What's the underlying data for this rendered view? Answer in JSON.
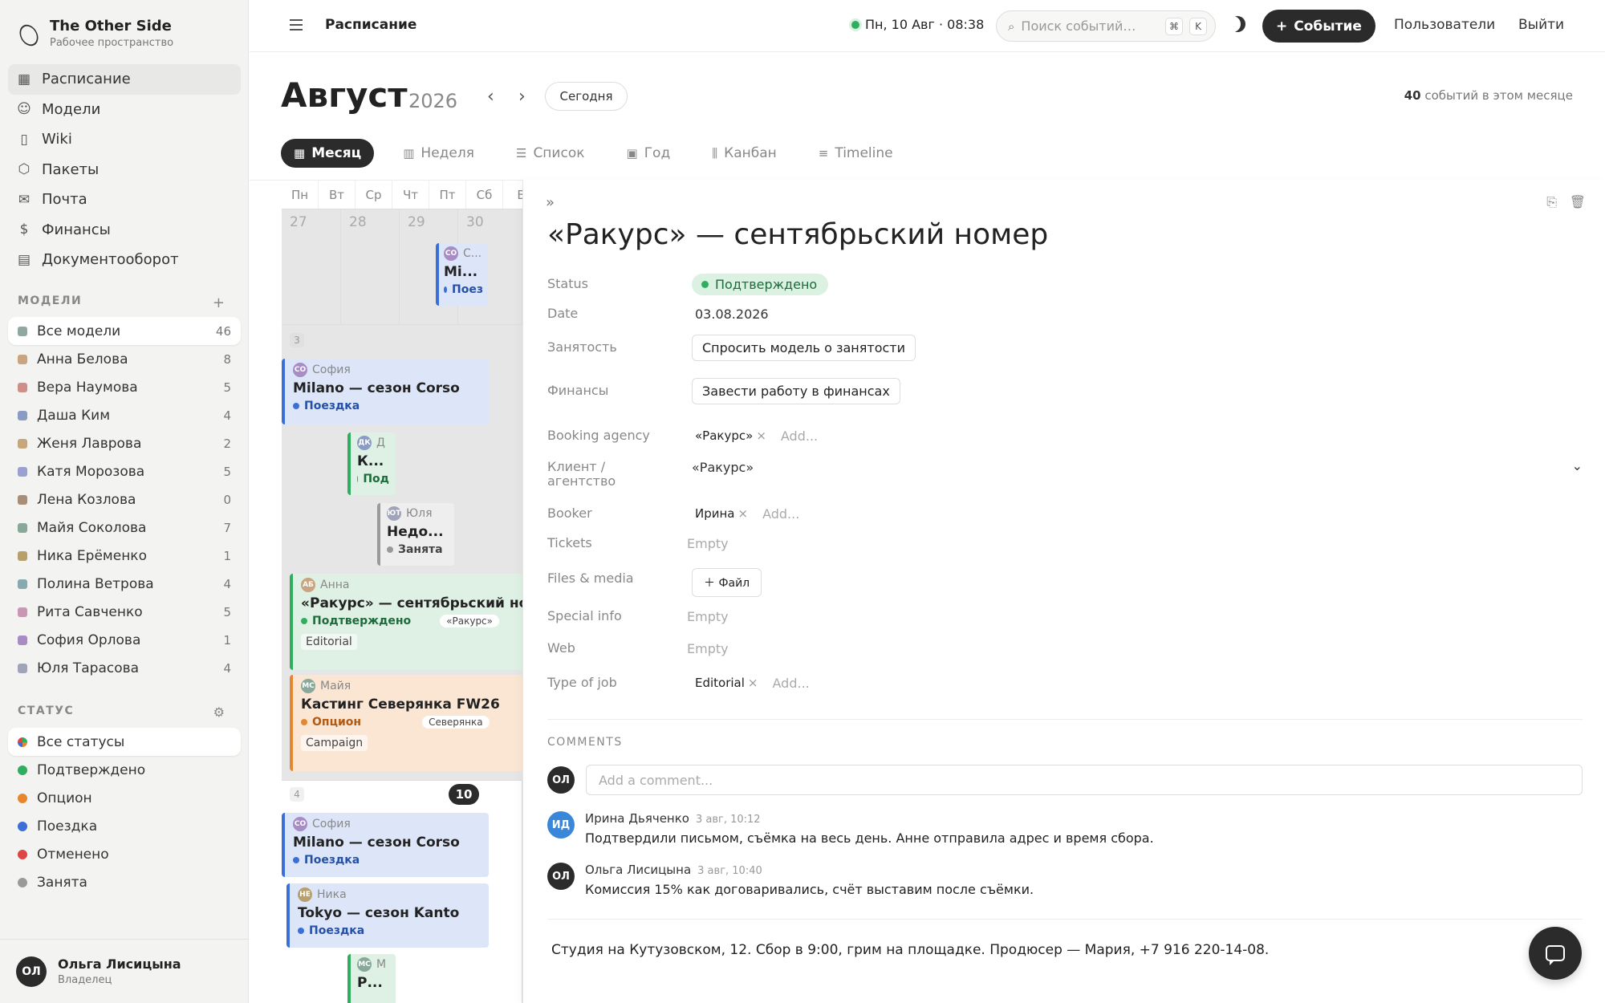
{
  "brand": {
    "title": "The Other Side",
    "subtitle": "Рабочее пространство"
  },
  "nav": {
    "items": [
      {
        "label": "Расписание",
        "icon": "calendar-icon",
        "glyph": "▦"
      },
      {
        "label": "Модели",
        "icon": "users-icon",
        "glyph": "☺"
      },
      {
        "label": "Wiki",
        "icon": "book-icon",
        "glyph": "▯"
      },
      {
        "label": "Пакеты",
        "icon": "package-icon",
        "glyph": "⬡"
      },
      {
        "label": "Почта",
        "icon": "mail-icon",
        "glyph": "✉"
      },
      {
        "label": "Финансы",
        "icon": "dollar-icon",
        "glyph": "$"
      },
      {
        "label": "Документооборот",
        "icon": "document-icon",
        "glyph": "▤"
      }
    ]
  },
  "models": {
    "heading": "МОДЕЛИ",
    "items": [
      {
        "label": "Все модели",
        "count": "46",
        "color": "#8fa8a0"
      },
      {
        "label": "Анна Белова",
        "count": "8",
        "color": "#c9a47e"
      },
      {
        "label": "Вера Наумова",
        "count": "5",
        "color": "#cf8e88"
      },
      {
        "label": "Даша Ким",
        "count": "4",
        "color": "#8a9cc4"
      },
      {
        "label": "Женя Лаврова",
        "count": "2",
        "color": "#c7a67c"
      },
      {
        "label": "Катя Морозова",
        "count": "5",
        "color": "#9aa0cf"
      },
      {
        "label": "Лена Козлова",
        "count": "0",
        "color": "#a88d78"
      },
      {
        "label": "Майя Соколова",
        "count": "7",
        "color": "#88a89a"
      },
      {
        "label": "Ника Ерёменко",
        "count": "1",
        "color": "#b8a06c"
      },
      {
        "label": "Полина Ветрова",
        "count": "4",
        "color": "#86aab0"
      },
      {
        "label": "Рита Савченко",
        "count": "5",
        "color": "#c996b4"
      },
      {
        "label": "София Орлова",
        "count": "1",
        "color": "#a88cc4"
      },
      {
        "label": "Юля Тарасова",
        "count": "4",
        "color": "#a0a4b8"
      }
    ]
  },
  "statuses": {
    "heading": "СТАТУС",
    "items": [
      {
        "label": "Все статусы",
        "color": "#e08a3a"
      },
      {
        "label": "Подтверждено",
        "color": "#2fae5f"
      },
      {
        "label": "Опцион",
        "color": "#e6862f"
      },
      {
        "label": "Поездка",
        "color": "#3a6fd8"
      },
      {
        "label": "Отменено",
        "color": "#e04545"
      },
      {
        "label": "Занята",
        "color": "#9a9a9a"
      }
    ]
  },
  "user": {
    "initials": "ОЛ",
    "name": "Ольга Лисицына",
    "role": "Владелец"
  },
  "topbar": {
    "title": "Расписание",
    "datetime": "Пн, 10 Авг · 08:38",
    "search_placeholder": "Поиск событий…",
    "kbd1": "⌘",
    "kbd2": "K",
    "new_event": "Событие",
    "users": "Пользователи",
    "logout": "Выйти"
  },
  "header": {
    "month": "Август",
    "year": "2026",
    "prev": "‹",
    "next": "›",
    "today": "Сегодня",
    "count": "40",
    "count_suffix": "событий в этом месяце"
  },
  "views": [
    {
      "label": "Месяц",
      "glyph": "▦"
    },
    {
      "label": "Неделя",
      "glyph": "▥"
    },
    {
      "label": "Список",
      "glyph": "☰"
    },
    {
      "label": "Год",
      "glyph": "▣"
    },
    {
      "label": "Канбан",
      "glyph": "⫼"
    },
    {
      "label": "Timeline",
      "glyph": "≡"
    }
  ],
  "calendar": {
    "dows": [
      "Пн",
      "Вт",
      "Ср",
      "Чт",
      "Пт",
      "Сб",
      "В"
    ],
    "week1": {
      "days": [
        "27",
        "28",
        "29",
        "30"
      ]
    },
    "week2": {
      "num": "3"
    },
    "week3": {
      "num": "4",
      "today": "10"
    },
    "events": [
      {
        "who": "С...",
        "initials": "СО",
        "avcolor": "#a88cc4",
        "title": "Mi...",
        "status": "Поез"
      },
      {
        "who": "София",
        "initials": "СО",
        "avcolor": "#a88cc4",
        "title": "Milano — сезон Corso",
        "status": "Поездка"
      },
      {
        "who": "Д",
        "initials": "ДК",
        "avcolor": "#8a9cc4",
        "title": "К...",
        "status": "Под"
      },
      {
        "who": "Юля",
        "initials": "ЮТ",
        "avcolor": "#a0a4b8",
        "title": "Недо...",
        "status": "Занята"
      },
      {
        "who": "Анна",
        "initials": "АБ",
        "avcolor": "#c9a47e",
        "title": "«Ракурс» — сентябрьский номер",
        "status": "Подтверждено",
        "side": "«Ракурс»",
        "tag": "Editorial"
      },
      {
        "who": "Майя",
        "initials": "МС",
        "avcolor": "#88a89a",
        "title": "Кастинг Северянка FW26",
        "status": "Опцион",
        "side": "Северянка",
        "tag": "Campaign"
      },
      {
        "who": "София",
        "initials": "СО",
        "avcolor": "#a88cc4",
        "title": "Milano — сезон Corso",
        "status": "Поездка"
      },
      {
        "who": "Ника",
        "initials": "НЕ",
        "avcolor": "#b8a06c",
        "title": "Tokyo — сезон Kanto",
        "status": "Поездка"
      },
      {
        "who": "М",
        "initials": "МС",
        "avcolor": "#88a89a",
        "title": "Р..."
      }
    ]
  },
  "detail": {
    "title": "«Ракурс» — сентябрьский номер",
    "expand": "»",
    "copy": "⎘",
    "trash": "🗑",
    "props": {
      "status_label": "Status",
      "status_value": "Подтверждено",
      "date_label": "Date",
      "date_value": "03.08.2026",
      "busy_label": "Занятость",
      "busy_btn": "Спросить модель о занятости",
      "fin_label": "Финансы",
      "fin_btn": "Завести работу в финансах",
      "agency_label": "Booking agency",
      "agency_chip": "«Ракурс»",
      "client_label": "Клиент / агентство",
      "client_value": "«Ракурс»",
      "booker_label": "Booker",
      "booker_chip": "Ирина",
      "tickets_label": "Tickets",
      "files_label": "Files & media",
      "files_btn": "＋ Файл",
      "special_label": "Special info",
      "web_label": "Web",
      "job_label": "Type of job",
      "job_chip": "Editorial",
      "add": "Add...",
      "empty": "Empty",
      "x": "×"
    },
    "comments": {
      "heading": "COMMENTS",
      "placeholder": "Add a comment...",
      "me": "ОЛ",
      "items": [
        {
          "initials": "ИД",
          "color": "#3a86d8",
          "author": "Ирина Дьяченко",
          "time": "3 авг, 10:12",
          "text": "Подтвердили письмом, съёмка на весь день. Анне отправила адрес и время сбора."
        },
        {
          "initials": "ОЛ",
          "color": "#2b2b2b",
          "author": "Ольга Лисицына",
          "time": "3 авг, 10:40",
          "text": "Комиссия 15% как договаривались, счёт выставим после съёмки."
        }
      ]
    },
    "note": "Студия на Кутузовском, 12. Сбор в 9:00, грим на площадке. Продюсер — Мария, +7 916 220-14-08."
  }
}
